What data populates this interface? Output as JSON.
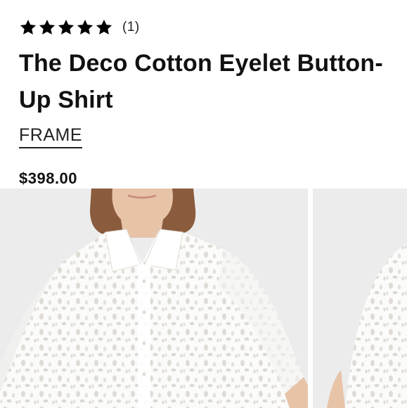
{
  "product": {
    "rating": 5,
    "rating_max": 5,
    "review_count": "(1)",
    "title": "The Deco Cotton Eyelet Button-Up Shirt",
    "brand": "FRAME",
    "price": "$398.00"
  },
  "gallery": {
    "images": [
      {
        "subject": "model wearing white eyelet button-up shirt, front view"
      },
      {
        "subject": "model wearing white eyelet button-up shirt, alternate view"
      }
    ]
  },
  "colors": {
    "text": "#111111",
    "star": "#000000",
    "photo_background": "#ececec",
    "shirt": "#fbfbfa",
    "hair": "#8a5b3c",
    "skin": "#e7c3a8"
  },
  "icons": {
    "star": "star-icon"
  }
}
